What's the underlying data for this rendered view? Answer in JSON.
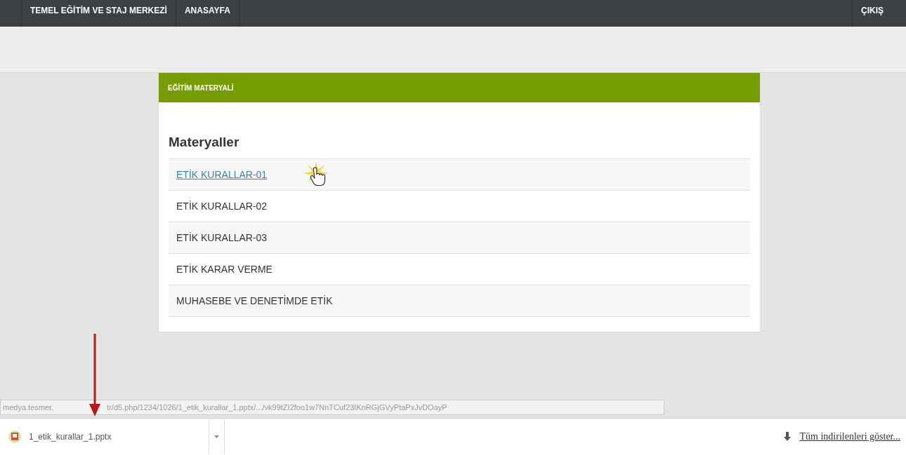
{
  "navbar": {
    "items": [
      {
        "label": "TEMEL EĞİTİM VE STAJ MERKEZİ"
      },
      {
        "label": "ANASAYFA"
      }
    ],
    "logout": "ÇIKIŞ"
  },
  "panel": {
    "title": "EĞİTİM MATERYALİ",
    "heading": "Materyaller",
    "items": [
      {
        "label": "ETİK KURALLAR-01",
        "hovered": true
      },
      {
        "label": "ETİK KURALLAR-02",
        "hovered": false
      },
      {
        "label": "ETİK KURALLAR-03",
        "hovered": false
      },
      {
        "label": "ETİK KARAR VERME",
        "hovered": false
      },
      {
        "label": "MUHASEBE VE DENETİMDE ETİK",
        "hovered": false
      }
    ]
  },
  "status_url": {
    "start": "medya.tesmer.",
    "end": "tr/d5.php/1234/1026/1_etik_kurallar_1.pptx/.../vk99tZI2foo1w7NnTCuf23IKnRGjGVyPtaPxJvDOayP"
  },
  "downloads": {
    "file": "1_etik_kurallar_1.pptx",
    "show_all": "Tüm indirilenleri göster..."
  }
}
